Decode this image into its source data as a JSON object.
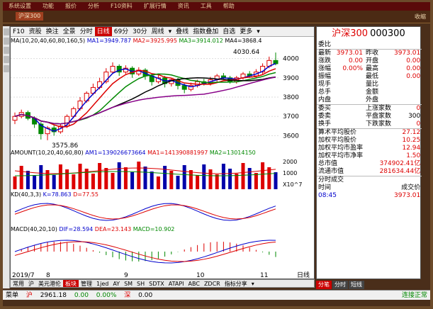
{
  "window": {
    "top_menu": [
      "系统设置",
      "功能",
      "报价",
      "分析",
      "F10资料",
      "扩展行情",
      "资讯",
      "工具",
      "帮助"
    ],
    "corner_text": "收缩"
  },
  "toolbar": {
    "items": [
      "F10",
      "资股",
      "换注",
      "全景",
      "分时",
      "日线",
      "69分",
      "30分",
      "周线",
      "▾",
      "叠线",
      "指数叠加",
      "自选",
      "更多",
      "▾"
    ],
    "active_index": 5
  },
  "ma_legend": {
    "title": "MA",
    "params": "(10,20,40,60,80,160,5)",
    "ma1": "MA1=3949.787",
    "ma2": "MA2=3925.995",
    "ma3": "MA3=3914.012",
    "ma4": "MA4=3868.4"
  },
  "price_chart": {
    "high_label": "4030.64",
    "low_label": "3575.86",
    "y_ticks": [
      "4000",
      "3900",
      "3800",
      "3700",
      "3600"
    ],
    "candles": [
      {
        "o": 3680,
        "c": 3700,
        "h": 3720,
        "l": 3660
      },
      {
        "o": 3700,
        "c": 3720,
        "h": 3735,
        "l": 3690
      },
      {
        "o": 3720,
        "c": 3690,
        "h": 3730,
        "l": 3680
      },
      {
        "o": 3690,
        "c": 3660,
        "h": 3700,
        "l": 3640
      },
      {
        "o": 3660,
        "c": 3610,
        "h": 3670,
        "l": 3580
      },
      {
        "o": 3610,
        "c": 3640,
        "h": 3650,
        "l": 3576
      },
      {
        "o": 3640,
        "c": 3620,
        "h": 3655,
        "l": 3600
      },
      {
        "o": 3620,
        "c": 3650,
        "h": 3660,
        "l": 3610
      },
      {
        "o": 3650,
        "c": 3700,
        "h": 3710,
        "l": 3640
      },
      {
        "o": 3700,
        "c": 3740,
        "h": 3750,
        "l": 3690
      },
      {
        "o": 3740,
        "c": 3780,
        "h": 3800,
        "l": 3730
      },
      {
        "o": 3780,
        "c": 3820,
        "h": 3830,
        "l": 3770
      },
      {
        "o": 3820,
        "c": 3850,
        "h": 3870,
        "l": 3810
      },
      {
        "o": 3850,
        "c": 3880,
        "h": 3900,
        "l": 3840
      },
      {
        "o": 3880,
        "c": 3930,
        "h": 3950,
        "l": 3870
      },
      {
        "o": 3930,
        "c": 3960,
        "h": 3980,
        "l": 3920
      },
      {
        "o": 3960,
        "c": 3930,
        "h": 3970,
        "l": 3910
      },
      {
        "o": 3930,
        "c": 3950,
        "h": 3965,
        "l": 3920
      },
      {
        "o": 3950,
        "c": 3920,
        "h": 3960,
        "l": 3900
      },
      {
        "o": 3920,
        "c": 3940,
        "h": 3955,
        "l": 3910
      },
      {
        "o": 3940,
        "c": 3910,
        "h": 3950,
        "l": 3890
      },
      {
        "o": 3910,
        "c": 3880,
        "h": 3920,
        "l": 3860
      },
      {
        "o": 3880,
        "c": 3900,
        "h": 3915,
        "l": 3870
      },
      {
        "o": 3900,
        "c": 3870,
        "h": 3910,
        "l": 3850
      },
      {
        "o": 3870,
        "c": 3890,
        "h": 3900,
        "l": 3855
      },
      {
        "o": 3890,
        "c": 3860,
        "h": 3900,
        "l": 3840
      },
      {
        "o": 3860,
        "c": 3840,
        "h": 3870,
        "l": 3820
      },
      {
        "o": 3840,
        "c": 3860,
        "h": 3875,
        "l": 3830
      },
      {
        "o": 3860,
        "c": 3880,
        "h": 3890,
        "l": 3850
      },
      {
        "o": 3880,
        "c": 3870,
        "h": 3895,
        "l": 3860
      },
      {
        "o": 3870,
        "c": 3890,
        "h": 3905,
        "l": 3860
      },
      {
        "o": 3890,
        "c": 3910,
        "h": 3920,
        "l": 3880
      },
      {
        "o": 3910,
        "c": 3900,
        "h": 3925,
        "l": 3890
      },
      {
        "o": 3900,
        "c": 3880,
        "h": 3910,
        "l": 3870
      },
      {
        "o": 3880,
        "c": 3900,
        "h": 3910,
        "l": 3870
      },
      {
        "o": 3900,
        "c": 3920,
        "h": 3930,
        "l": 3890
      },
      {
        "o": 3920,
        "c": 3910,
        "h": 3935,
        "l": 3900
      },
      {
        "o": 3910,
        "c": 3930,
        "h": 3945,
        "l": 3900
      },
      {
        "o": 3930,
        "c": 3960,
        "h": 3975,
        "l": 3920
      },
      {
        "o": 3960,
        "c": 3990,
        "h": 4010,
        "l": 3950
      },
      {
        "o": 3990,
        "c": 3973,
        "h": 4031,
        "l": 3965
      }
    ]
  },
  "amount": {
    "label": "AMOUNT",
    "params": "(10,20,40,60,80)",
    "am1": "AM1=139026673664",
    "ma1": "MA1=141390881997",
    "ma2": "MA2=13014150",
    "y_ticks": [
      "2000",
      "1000",
      "X10^7"
    ]
  },
  "kd": {
    "label": "KD",
    "params": "(40,3,3)",
    "k": "K=78.863",
    "d": "D=77.55"
  },
  "macd": {
    "label": "MACD",
    "params": "(40,20,10)",
    "dif": "DIF=28.594",
    "dea": "DEA=23.143",
    "macd": "MACD=10.902"
  },
  "x_axis": [
    "2019/7",
    "8",
    "9",
    "10",
    "11"
  ],
  "x_axis_suffix": "日线",
  "quote": {
    "name": "沪深300",
    "code": "000300",
    "title_row": "委比",
    "rows": [
      {
        "l1": "最新",
        "v1": "3973.01",
        "l2": "昨收",
        "v2": "3973.01"
      },
      {
        "l1": "涨跌",
        "v1": "0.00",
        "l2": "开盘",
        "v2": "0.00"
      },
      {
        "l1": "涨幅",
        "v1": "0.00%",
        "l2": "最高",
        "v2": "0.00"
      },
      {
        "l1": "振幅",
        "v1": "",
        "l2": "最低",
        "v2": "0.00"
      },
      {
        "l1": "现手",
        "v1": "",
        "l2": "量比",
        "v2": ""
      },
      {
        "l1": "总手",
        "v1": "",
        "l2": "金额",
        "v2": ""
      },
      {
        "l1": "内盘",
        "v1": "",
        "l2": "外盘",
        "v2": ""
      }
    ],
    "rows2": [
      {
        "l1": "委买",
        "v1": "",
        "l2": "上涨家数",
        "v2": "0"
      },
      {
        "l1": "委卖",
        "v1": "",
        "l2": "平盘家数",
        "v2": "300"
      },
      {
        "l1": "换手",
        "v1": "",
        "l2": "下跌家数",
        "v2": "0"
      }
    ],
    "stats": [
      {
        "k": "算术平均股价",
        "v": "27.12"
      },
      {
        "k": "加权平均股价",
        "v": "10.25"
      },
      {
        "k": "加权平均市盈率",
        "v": "12.94"
      },
      {
        "k": "加权平均市净率",
        "v": "1.50"
      },
      {
        "k": "总市值",
        "v": "374902.41亿"
      },
      {
        "k": "流通市值",
        "v": "281634.44亿"
      }
    ],
    "trades_header": "分时成交",
    "trades_cols": [
      "时间",
      "成交价"
    ],
    "trades": [
      {
        "t": "08:45",
        "p": "3973.01"
      }
    ]
  },
  "bottom_tabs": [
    "常用",
    "沪",
    "美元港伦",
    "板块",
    "管理",
    "1jed",
    "AY",
    "SM",
    "SH",
    "SDTX",
    "ATAPI",
    "ABC",
    "ZDCR",
    "指标分享",
    "▾"
  ],
  "bottom_tabs_active": 3,
  "right_tabs": [
    "分笔",
    "分时",
    "短线"
  ],
  "status": {
    "menu": "菜单",
    "idx1_name": "沪",
    "idx1_val": "2961.18",
    "idx1_chg": "0.00",
    "idx1_pct": "0.00%",
    "idx2_name": "深",
    "idx2_val": "0.00",
    "conn": "连接正常"
  }
}
